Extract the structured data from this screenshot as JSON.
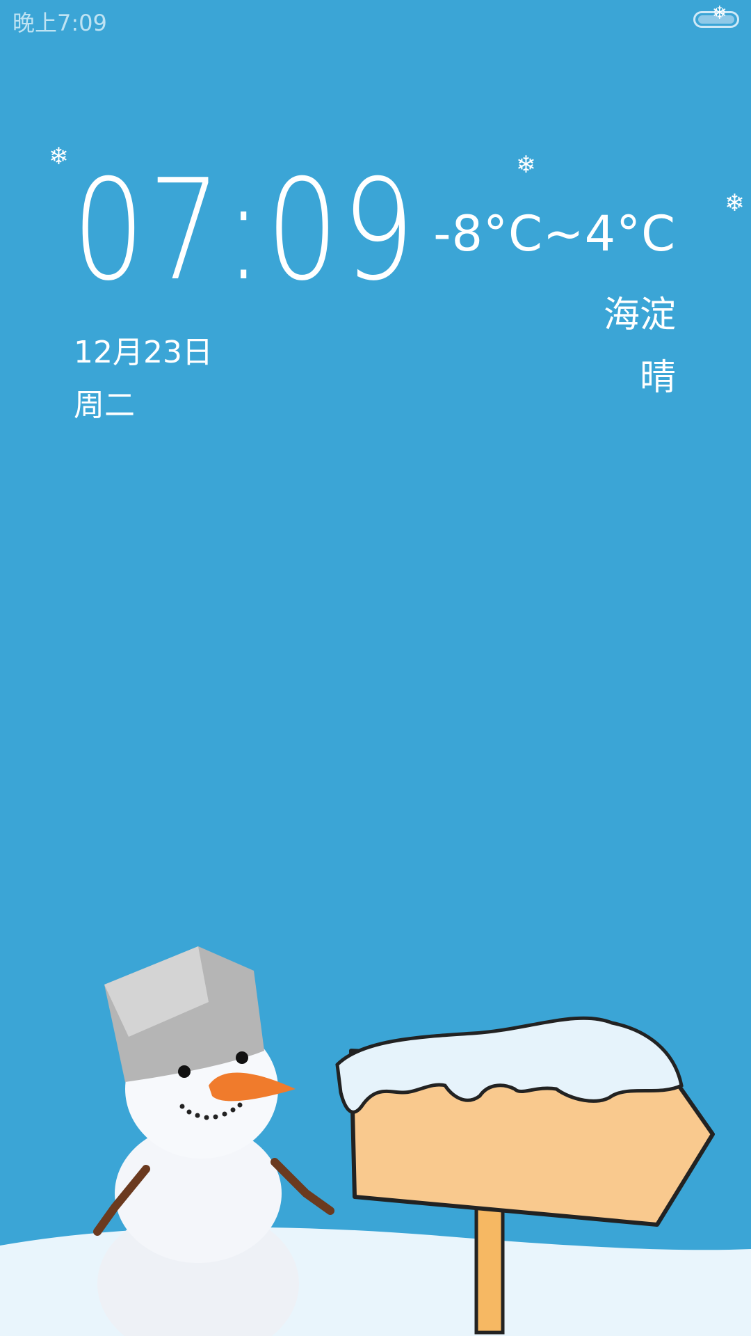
{
  "status_bar": {
    "time": "晚上7:09",
    "battery_icon": "battery-icon"
  },
  "clock": {
    "time": "07:09",
    "date": "12月23日",
    "weekday": "周二"
  },
  "weather": {
    "temperature_range": "-8°C~4°C",
    "location": "海淀",
    "condition": "晴"
  },
  "colors": {
    "background": "#3ba5d6",
    "snow_ground": "#e9f5fc",
    "text": "#ffffff"
  },
  "wallpaper": {
    "decorations": [
      "snowflake-icon",
      "snowman-illustration",
      "wooden-sign-illustration"
    ]
  }
}
